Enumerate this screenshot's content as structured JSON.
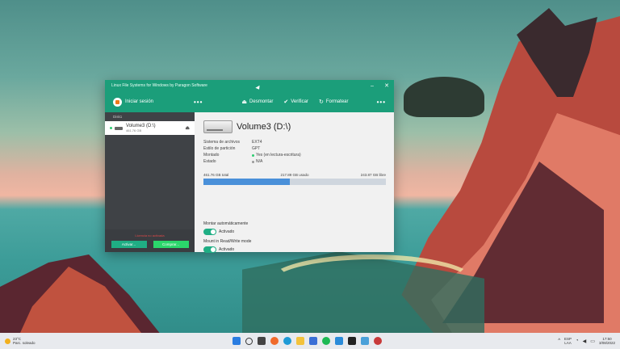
{
  "window": {
    "title": "Linux File Systems for Windows by Paragon Software",
    "controls": {
      "minimize": "–",
      "close": "✕"
    }
  },
  "toolbar": {
    "signin_label": "Iniciar sesión",
    "more_left": "•••",
    "unmount_label": "Desmontar",
    "verify_label": "Verificar",
    "format_label": "Formatear",
    "more_right": "•••"
  },
  "sidebar": {
    "header": "Disk1",
    "volume": {
      "name": "Volume3 (D:\\)",
      "size": "461.76 GB"
    },
    "warning": "Licencia no activada",
    "activate_label": "Activar...",
    "buy_label": "Comprar..."
  },
  "main": {
    "title": "Volume3 (D:\\)",
    "props": [
      {
        "key": "Sistema de archivos",
        "value": "EXT4"
      },
      {
        "key": "Estilo de partición",
        "value": "GPT"
      },
      {
        "key": "Montado",
        "value": "Yes (en lectura-escritura)",
        "dot": "#2ecc71"
      },
      {
        "key": "Estado",
        "value": "N/A",
        "dot": "#999999"
      }
    ],
    "usage": {
      "total": "461.76 GB total",
      "used": "217.89 GB usado",
      "free": "243.87 GB libre",
      "used_fraction": 0.472
    },
    "auto_mount_label": "Montar automáticamente",
    "auto_mount_state": "Activado",
    "rw_label": "Mount in Read/Write mode",
    "rw_state": "Activado"
  },
  "taskbar": {
    "weather_temp": "23°C",
    "weather_desc": "Parc. soleado",
    "lang_top": "ESP",
    "lang_bottom": "LAA",
    "time": "17:50",
    "date": "3/08/2022",
    "apps": [
      "windows-start",
      "search",
      "task-view",
      "firefox",
      "edge",
      "file-explorer",
      "store",
      "spotify",
      "vscode",
      "terminal",
      "photos",
      "app-extra"
    ]
  }
}
